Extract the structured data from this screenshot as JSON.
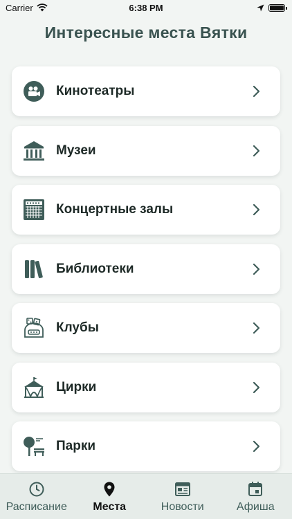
{
  "status": {
    "carrier": "Carrier",
    "time": "6:38 PM"
  },
  "title": "Интересные места Вятки",
  "colors": {
    "accent": "#3f5d59",
    "title": "#3a5350",
    "background": "#f2f5f3",
    "card": "#ffffff"
  },
  "places": [
    {
      "label": "Кинотеатры",
      "icon": "film-camera-icon"
    },
    {
      "label": "Музеи",
      "icon": "museum-icon"
    },
    {
      "label": "Концертные залы",
      "icon": "concert-hall-icon"
    },
    {
      "label": "Библиотеки",
      "icon": "books-icon"
    },
    {
      "label": "Клубы",
      "icon": "club-icon"
    },
    {
      "label": "Цирки",
      "icon": "circus-tent-icon"
    },
    {
      "label": "Парки",
      "icon": "park-icon"
    }
  ],
  "tabs": [
    {
      "label": "Расписание",
      "icon": "clock-icon",
      "active": false
    },
    {
      "label": "Места",
      "icon": "map-pin-icon",
      "active": true
    },
    {
      "label": "Новости",
      "icon": "news-icon",
      "active": false
    },
    {
      "label": "Афиша",
      "icon": "calendar-icon",
      "active": false
    }
  ]
}
